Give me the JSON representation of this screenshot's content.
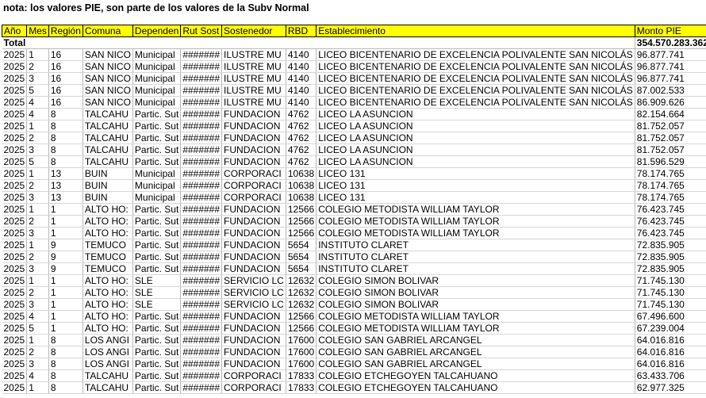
{
  "note": "nota: los valores PIE, son parte de los valores de la Subv Normal",
  "headers": [
    "Año",
    "Mes",
    "Región",
    "Comuna",
    "Dependen",
    "Rut Sost",
    "Sostenedor",
    "RBD",
    "Establecimiento",
    "Monto PIE"
  ],
  "total": {
    "label": "Total",
    "amount": "354.570.283.362"
  },
  "rows": [
    [
      "2025",
      "1",
      "16",
      "SAN NICO",
      "Municipal",
      "#######",
      "ILUSTRE MU",
      "4140",
      "LICEO BICENTENARIO DE EXCELENCIA POLIVALENTE SAN NICOLÁS",
      "96.877.741"
    ],
    [
      "2025",
      "2",
      "16",
      "SAN NICO",
      "Municipal",
      "#######",
      "ILUSTRE MU",
      "4140",
      "LICEO BICENTENARIO DE EXCELENCIA POLIVALENTE SAN NICOLÁS",
      "96.877.741"
    ],
    [
      "2025",
      "3",
      "16",
      "SAN NICO",
      "Municipal",
      "#######",
      "ILUSTRE MU",
      "4140",
      "LICEO BICENTENARIO DE EXCELENCIA POLIVALENTE SAN NICOLÁS",
      "96.877.741"
    ],
    [
      "2025",
      "5",
      "16",
      "SAN NICO",
      "Municipal",
      "#######",
      "ILUSTRE MU",
      "4140",
      "LICEO BICENTENARIO DE EXCELENCIA POLIVALENTE SAN NICOLÁS",
      "87.002.533"
    ],
    [
      "2025",
      "4",
      "16",
      "SAN NICO",
      "Municipal",
      "#######",
      "ILUSTRE MU",
      "4140",
      "LICEO BICENTENARIO DE EXCELENCIA POLIVALENTE SAN NICOLÁS",
      "86.909.626"
    ],
    [
      "2025",
      "4",
      "8",
      "TALCAHU",
      "Partic. Sut",
      "#######",
      "FUNDACION",
      "4762",
      "LICEO LA ASUNCION",
      "82.154.664"
    ],
    [
      "2025",
      "1",
      "8",
      "TALCAHU",
      "Partic. Sut",
      "#######",
      "FUNDACION",
      "4762",
      "LICEO LA ASUNCION",
      "81.752.057"
    ],
    [
      "2025",
      "2",
      "8",
      "TALCAHU",
      "Partic. Sut",
      "#######",
      "FUNDACION",
      "4762",
      "LICEO LA ASUNCION",
      "81.752.057"
    ],
    [
      "2025",
      "3",
      "8",
      "TALCAHU",
      "Partic. Sut",
      "#######",
      "FUNDACION",
      "4762",
      "LICEO LA ASUNCION",
      "81.752.057"
    ],
    [
      "2025",
      "5",
      "8",
      "TALCAHU",
      "Partic. Sut",
      "#######",
      "FUNDACION",
      "4762",
      "LICEO LA ASUNCION",
      "81.596.529"
    ],
    [
      "2025",
      "1",
      "13",
      "BUIN",
      "Municipal",
      "#######",
      "CORPORACI",
      "10638",
      "LICEO 131",
      "78.174.765"
    ],
    [
      "2025",
      "2",
      "13",
      "BUIN",
      "Municipal",
      "#######",
      "CORPORACI",
      "10638",
      "LICEO 131",
      "78.174.765"
    ],
    [
      "2025",
      "3",
      "13",
      "BUIN",
      "Municipal",
      "#######",
      "CORPORACI",
      "10638",
      "LICEO 131",
      "78.174.765"
    ],
    [
      "2025",
      "1",
      "1",
      "ALTO HO:",
      "Partic. Sut",
      "#######",
      "FUNDACION",
      "12566",
      "COLEGIO METODISTA WILLIAM TAYLOR",
      "76.423.745"
    ],
    [
      "2025",
      "2",
      "1",
      "ALTO HO:",
      "Partic. Sut",
      "#######",
      "FUNDACION",
      "12566",
      "COLEGIO METODISTA WILLIAM TAYLOR",
      "76.423.745"
    ],
    [
      "2025",
      "3",
      "1",
      "ALTO HO:",
      "Partic. Sut",
      "#######",
      "FUNDACION",
      "12566",
      "COLEGIO METODISTA WILLIAM TAYLOR",
      "76.423.745"
    ],
    [
      "2025",
      "1",
      "9",
      "TEMUCO",
      "Partic. Sut",
      "#######",
      "FUNDACION",
      "5654",
      "INSTITUTO CLARET",
      "72.835.905"
    ],
    [
      "2025",
      "2",
      "9",
      "TEMUCO",
      "Partic. Sut",
      "#######",
      "FUNDACION",
      "5654",
      "INSTITUTO CLARET",
      "72.835.905"
    ],
    [
      "2025",
      "3",
      "9",
      "TEMUCO",
      "Partic. Sut",
      "#######",
      "FUNDACION",
      "5654",
      "INSTITUTO CLARET",
      "72.835.905"
    ],
    [
      "2025",
      "1",
      "1",
      "ALTO HO:",
      "SLE",
      "#######",
      "SERVICIO LC",
      "12632",
      "COLEGIO SIMON BOLIVAR",
      "71.745.130"
    ],
    [
      "2025",
      "2",
      "1",
      "ALTO HO:",
      "SLE",
      "#######",
      "SERVICIO LC",
      "12632",
      "COLEGIO SIMON BOLIVAR",
      "71.745.130"
    ],
    [
      "2025",
      "3",
      "1",
      "ALTO HO:",
      "SLE",
      "#######",
      "SERVICIO LC",
      "12632",
      "COLEGIO SIMON BOLIVAR",
      "71.745.130"
    ],
    [
      "2025",
      "4",
      "1",
      "ALTO HO:",
      "Partic. Sut",
      "#######",
      "FUNDACION",
      "12566",
      "COLEGIO METODISTA WILLIAM TAYLOR",
      "67.496.600"
    ],
    [
      "2025",
      "5",
      "1",
      "ALTO HO:",
      "Partic. Sut",
      "#######",
      "FUNDACION",
      "12566",
      "COLEGIO METODISTA WILLIAM TAYLOR",
      "67.239.004"
    ],
    [
      "2025",
      "1",
      "8",
      "LOS ANGI",
      "Partic. Sut",
      "#######",
      "FUNDACION",
      "17600",
      "COLEGIO SAN GABRIEL ARCANGEL",
      "64.016.816"
    ],
    [
      "2025",
      "2",
      "8",
      "LOS ANGI",
      "Partic. Sut",
      "#######",
      "FUNDACION",
      "17600",
      "COLEGIO SAN GABRIEL ARCANGEL",
      "64.016.816"
    ],
    [
      "2025",
      "3",
      "8",
      "LOS ANGI",
      "Partic. Sut",
      "#######",
      "FUNDACION",
      "17600",
      "COLEGIO SAN GABRIEL ARCANGEL",
      "64.016.816"
    ],
    [
      "2025",
      "4",
      "8",
      "TALCAHU",
      "Partic. Sut",
      "#######",
      "CORPORACI",
      "17833",
      "COLEGIO ETCHEGOYEN TALCAHUANO",
      "63.433.706"
    ],
    [
      "2025",
      "1",
      "8",
      "TALCAHU",
      "Partic. Sut",
      "#######",
      "CORPORACI",
      "17833",
      "COLEGIO ETCHEGOYEN TALCAHUANO",
      "62.977.325"
    ]
  ]
}
